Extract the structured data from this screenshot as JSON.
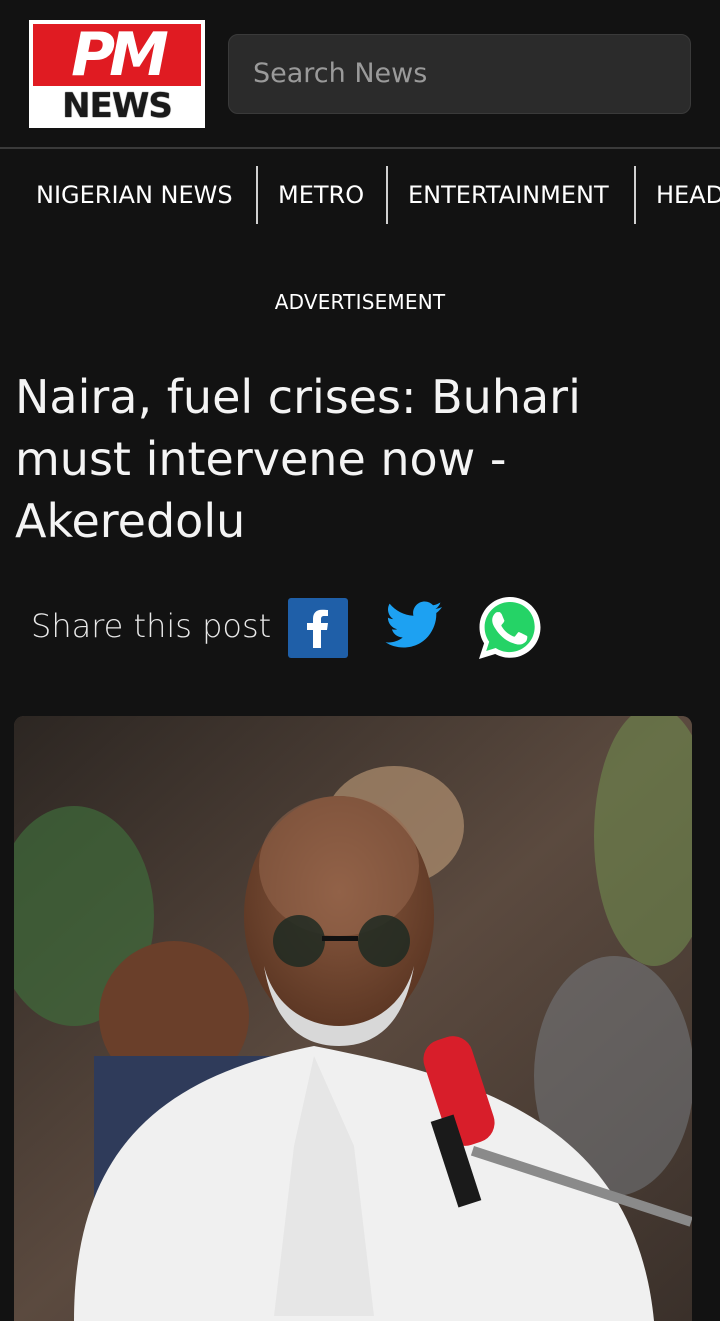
{
  "header": {
    "logo_top": "PM",
    "logo_bottom": "NEWS",
    "search_placeholder": "Search News"
  },
  "nav": {
    "items": [
      "NIGERIAN NEWS",
      "METRO",
      "ENTERTAINMENT",
      "HEAD"
    ]
  },
  "advertisement_label": "ADVERTISEMENT",
  "article": {
    "headline": "Naira, fuel crises: Buhari must intervene now - Akeredolu",
    "share_label": "Share this post"
  },
  "colors": {
    "background": "#121212",
    "logo_red": "#e01b22",
    "facebook": "#1f5fa8",
    "twitter": "#1da1f2",
    "whatsapp": "#25d366"
  },
  "icons": [
    "facebook-icon",
    "twitter-icon",
    "whatsapp-icon"
  ]
}
